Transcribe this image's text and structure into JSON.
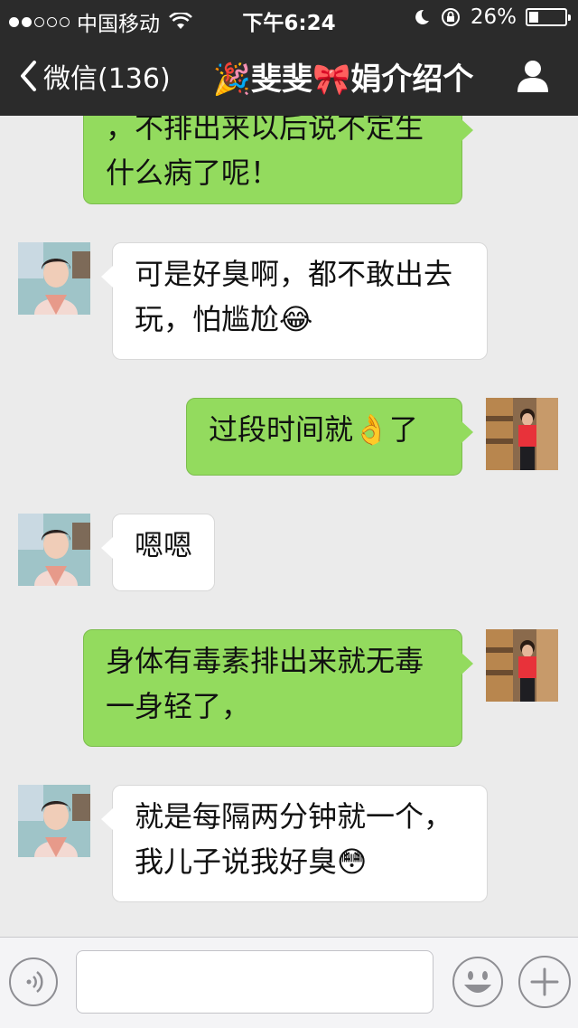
{
  "status_bar": {
    "carrier": "中国移动",
    "time": "下午6:24",
    "battery": "26%",
    "battery_level": 0.26
  },
  "nav": {
    "back_label": "微信(136)",
    "title": "🎉斐斐🎀娟介绍个"
  },
  "messages": [
    {
      "side": "out",
      "text": "，不排出来以后说不定生什么病了呢！"
    },
    {
      "side": "in",
      "text": "可是好臭啊，都不敢出去玩，怕尴尬😂"
    },
    {
      "side": "out",
      "text": "过段时间就👌了"
    },
    {
      "side": "in",
      "text": "嗯嗯"
    },
    {
      "side": "out",
      "text": "身体有毒素排出来就无毒一身轻了，"
    },
    {
      "side": "in",
      "text": "就是每隔两分钟就一个，我儿子说我好臭😳"
    }
  ],
  "input": {
    "placeholder": ""
  },
  "colors": {
    "outgoing_bubble": "#93db5e",
    "incoming_bubble": "#ffffff",
    "chat_background": "#ebebeb",
    "header": "#2b2b2b"
  },
  "icons": {
    "back": "chevron-left-icon",
    "profile": "person-icon",
    "voice": "voice-icon",
    "emoji": "smiley-icon",
    "plus": "plus-icon"
  }
}
